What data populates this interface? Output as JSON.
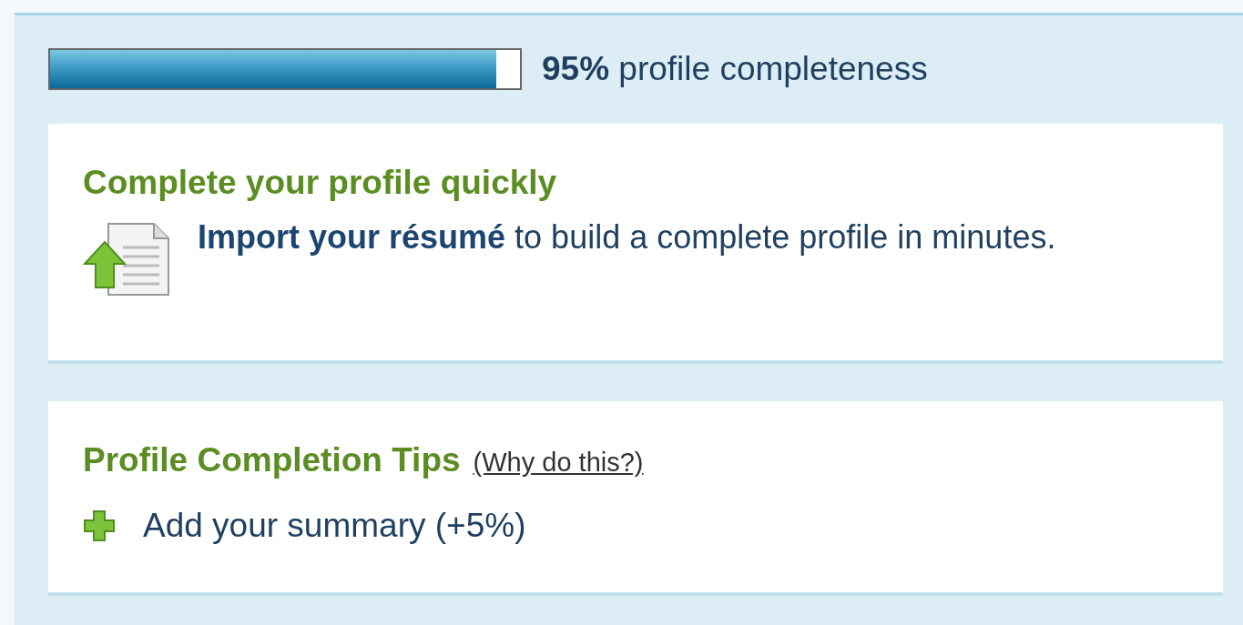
{
  "progress": {
    "level": 0.95,
    "percent": "95%",
    "label": "profile completeness"
  },
  "quick_card": {
    "title": "Complete your profile quickly",
    "link": "Import your résumé",
    "text": " to build a complete profile in minutes."
  },
  "tips_card": {
    "title": "Profile Completion Tips",
    "why_link": "(Why do this?)",
    "items": [
      {
        "label": "Add your summary (+5%)"
      }
    ]
  }
}
